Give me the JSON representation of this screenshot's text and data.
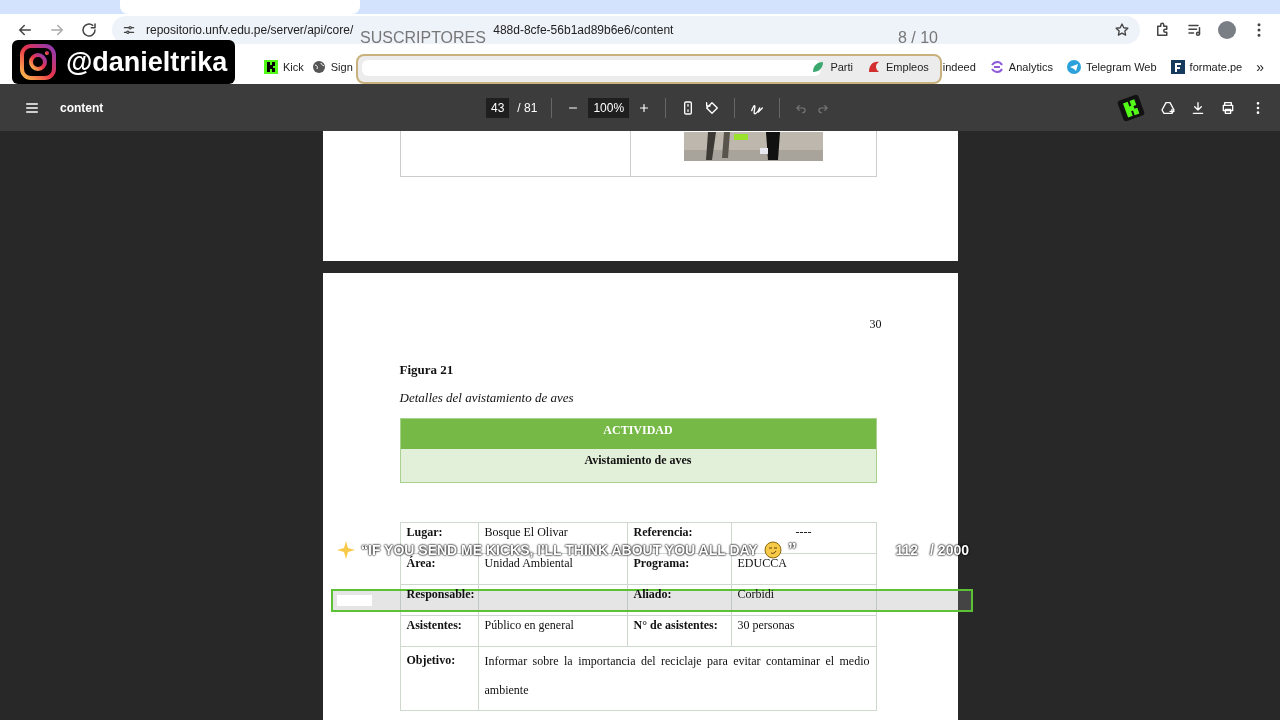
{
  "browser": {
    "url_start": "repositorio.unfv.edu.pe/server/api/core/",
    "url_end": "488d-8cfe-56b1ad89b6e6/content"
  },
  "bookmarks": [
    {
      "label": "Kick",
      "kind": "kick"
    },
    {
      "label": "Sign",
      "kind": "globe"
    },
    {
      "label": "Parti",
      "kind": "leaf"
    },
    {
      "label": "Empleos",
      "kind": "red"
    },
    {
      "label": "indeed",
      "kind": "plain"
    },
    {
      "label": "Analytics",
      "kind": "analytics"
    },
    {
      "label": "Telegram Web",
      "kind": "telegram"
    },
    {
      "label": "formate.pe",
      "kind": "square"
    }
  ],
  "bookmarks_overflow": "»",
  "viewer": {
    "title": "content",
    "page": "43",
    "page_total": "/ 81",
    "zoom": "100%"
  },
  "document": {
    "page_number": "30",
    "figure_label": "Figura 21",
    "figure_caption": "Detalles del avistamiento de aves",
    "activity_header": "ACTIVIDAD",
    "activity_name": "Avistamiento de aves",
    "rows": [
      {
        "cells": [
          "Lugar:",
          "Bosque El Olivar",
          "Referencia:",
          "----"
        ]
      },
      {
        "cells": [
          "Área:",
          "Unidad Ambiental",
          "Programa:",
          "EDUCCA"
        ]
      },
      {
        "cells": [
          "Responsable:",
          "",
          "Aliado:",
          "Corbidi"
        ]
      },
      {
        "cells": [
          "Asistentes:",
          "Público en general",
          "N° de asistentes:",
          "30 personas"
        ]
      }
    ],
    "objective": {
      "label": "Objetivo:",
      "text": "Informar sobre la importancia del reciclaje para evitar contaminar el medio ambiente"
    }
  },
  "overlays": {
    "handle": "@danieltrika",
    "subs_goal": {
      "label": "SUSCRIPTORES",
      "count": "8",
      "total": "/ 10",
      "level": 0.8
    },
    "kicks_goal": {
      "message": "“IF YOU SEND ME KICKS, I'LL THINK ABOUT YOU ALL DAY",
      "closing": "”",
      "count": "112",
      "total": "/ 2000",
      "level": 0.056
    }
  }
}
